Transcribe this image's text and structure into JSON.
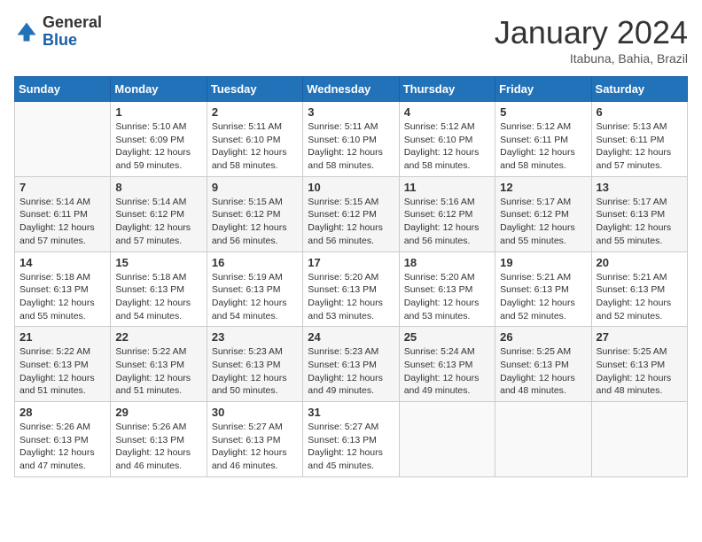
{
  "header": {
    "logo_general": "General",
    "logo_blue": "Blue",
    "month_title": "January 2024",
    "subtitle": "Itabuna, Bahia, Brazil"
  },
  "calendar": {
    "days_of_week": [
      "Sunday",
      "Monday",
      "Tuesday",
      "Wednesday",
      "Thursday",
      "Friday",
      "Saturday"
    ],
    "weeks": [
      [
        {
          "day": "",
          "info": ""
        },
        {
          "day": "1",
          "info": "Sunrise: 5:10 AM\nSunset: 6:09 PM\nDaylight: 12 hours\nand 59 minutes."
        },
        {
          "day": "2",
          "info": "Sunrise: 5:11 AM\nSunset: 6:10 PM\nDaylight: 12 hours\nand 58 minutes."
        },
        {
          "day": "3",
          "info": "Sunrise: 5:11 AM\nSunset: 6:10 PM\nDaylight: 12 hours\nand 58 minutes."
        },
        {
          "day": "4",
          "info": "Sunrise: 5:12 AM\nSunset: 6:10 PM\nDaylight: 12 hours\nand 58 minutes."
        },
        {
          "day": "5",
          "info": "Sunrise: 5:12 AM\nSunset: 6:11 PM\nDaylight: 12 hours\nand 58 minutes."
        },
        {
          "day": "6",
          "info": "Sunrise: 5:13 AM\nSunset: 6:11 PM\nDaylight: 12 hours\nand 57 minutes."
        }
      ],
      [
        {
          "day": "7",
          "info": "Sunrise: 5:14 AM\nSunset: 6:11 PM\nDaylight: 12 hours\nand 57 minutes."
        },
        {
          "day": "8",
          "info": "Sunrise: 5:14 AM\nSunset: 6:12 PM\nDaylight: 12 hours\nand 57 minutes."
        },
        {
          "day": "9",
          "info": "Sunrise: 5:15 AM\nSunset: 6:12 PM\nDaylight: 12 hours\nand 56 minutes."
        },
        {
          "day": "10",
          "info": "Sunrise: 5:15 AM\nSunset: 6:12 PM\nDaylight: 12 hours\nand 56 minutes."
        },
        {
          "day": "11",
          "info": "Sunrise: 5:16 AM\nSunset: 6:12 PM\nDaylight: 12 hours\nand 56 minutes."
        },
        {
          "day": "12",
          "info": "Sunrise: 5:17 AM\nSunset: 6:12 PM\nDaylight: 12 hours\nand 55 minutes."
        },
        {
          "day": "13",
          "info": "Sunrise: 5:17 AM\nSunset: 6:13 PM\nDaylight: 12 hours\nand 55 minutes."
        }
      ],
      [
        {
          "day": "14",
          "info": "Sunrise: 5:18 AM\nSunset: 6:13 PM\nDaylight: 12 hours\nand 55 minutes."
        },
        {
          "day": "15",
          "info": "Sunrise: 5:18 AM\nSunset: 6:13 PM\nDaylight: 12 hours\nand 54 minutes."
        },
        {
          "day": "16",
          "info": "Sunrise: 5:19 AM\nSunset: 6:13 PM\nDaylight: 12 hours\nand 54 minutes."
        },
        {
          "day": "17",
          "info": "Sunrise: 5:20 AM\nSunset: 6:13 PM\nDaylight: 12 hours\nand 53 minutes."
        },
        {
          "day": "18",
          "info": "Sunrise: 5:20 AM\nSunset: 6:13 PM\nDaylight: 12 hours\nand 53 minutes."
        },
        {
          "day": "19",
          "info": "Sunrise: 5:21 AM\nSunset: 6:13 PM\nDaylight: 12 hours\nand 52 minutes."
        },
        {
          "day": "20",
          "info": "Sunrise: 5:21 AM\nSunset: 6:13 PM\nDaylight: 12 hours\nand 52 minutes."
        }
      ],
      [
        {
          "day": "21",
          "info": "Sunrise: 5:22 AM\nSunset: 6:13 PM\nDaylight: 12 hours\nand 51 minutes."
        },
        {
          "day": "22",
          "info": "Sunrise: 5:22 AM\nSunset: 6:13 PM\nDaylight: 12 hours\nand 51 minutes."
        },
        {
          "day": "23",
          "info": "Sunrise: 5:23 AM\nSunset: 6:13 PM\nDaylight: 12 hours\nand 50 minutes."
        },
        {
          "day": "24",
          "info": "Sunrise: 5:23 AM\nSunset: 6:13 PM\nDaylight: 12 hours\nand 49 minutes."
        },
        {
          "day": "25",
          "info": "Sunrise: 5:24 AM\nSunset: 6:13 PM\nDaylight: 12 hours\nand 49 minutes."
        },
        {
          "day": "26",
          "info": "Sunrise: 5:25 AM\nSunset: 6:13 PM\nDaylight: 12 hours\nand 48 minutes."
        },
        {
          "day": "27",
          "info": "Sunrise: 5:25 AM\nSunset: 6:13 PM\nDaylight: 12 hours\nand 48 minutes."
        }
      ],
      [
        {
          "day": "28",
          "info": "Sunrise: 5:26 AM\nSunset: 6:13 PM\nDaylight: 12 hours\nand 47 minutes."
        },
        {
          "day": "29",
          "info": "Sunrise: 5:26 AM\nSunset: 6:13 PM\nDaylight: 12 hours\nand 46 minutes."
        },
        {
          "day": "30",
          "info": "Sunrise: 5:27 AM\nSunset: 6:13 PM\nDaylight: 12 hours\nand 46 minutes."
        },
        {
          "day": "31",
          "info": "Sunrise: 5:27 AM\nSunset: 6:13 PM\nDaylight: 12 hours\nand 45 minutes."
        },
        {
          "day": "",
          "info": ""
        },
        {
          "day": "",
          "info": ""
        },
        {
          "day": "",
          "info": ""
        }
      ]
    ]
  }
}
